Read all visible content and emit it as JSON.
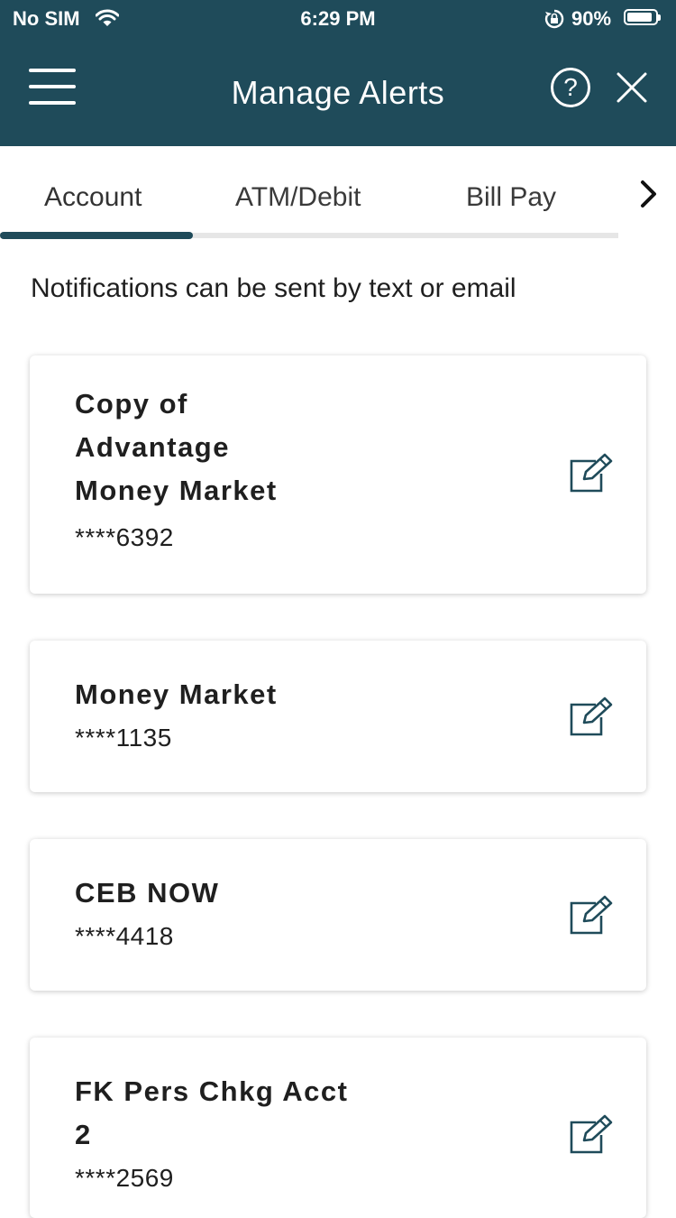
{
  "status_bar": {
    "carrier": "No SIM",
    "time": "6:29 PM",
    "battery": "90%",
    "battery_level": 0.9
  },
  "header": {
    "title": "Manage Alerts",
    "help_symbol": "?",
    "background": "#1f4b5a"
  },
  "tabs": [
    {
      "label": "Account",
      "selected": true
    },
    {
      "label": "ATM/Debit",
      "selected": false
    },
    {
      "label": "Bill Pay",
      "selected": false
    }
  ],
  "subtitle": "Notifications can be sent by text or email",
  "accounts": [
    {
      "name": "Copy of Advantage Money Market",
      "number": "****6392"
    },
    {
      "name": "Money Market",
      "number": "****1135"
    },
    {
      "name": "CEB NOW",
      "number": "****4418"
    },
    {
      "name": "FK Pers Chkg Acct 2",
      "number": "****2569"
    }
  ],
  "icons": {
    "menu": "hamburger-menu-icon",
    "help": "help-circle-icon",
    "close": "close-icon",
    "tabs_next": "chevron-right-icon",
    "edit": "edit-icon",
    "wifi": "wifi-icon",
    "orientation_lock": "orientation-lock-icon"
  }
}
